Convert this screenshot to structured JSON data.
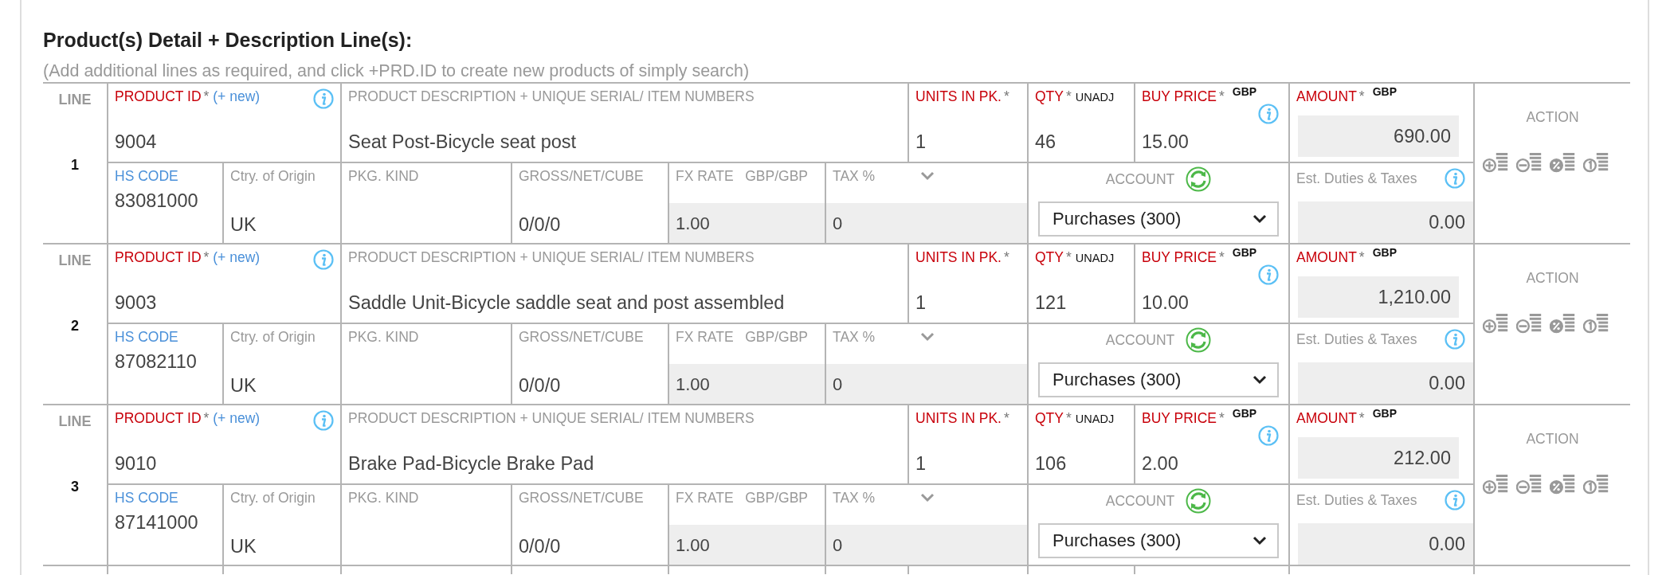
{
  "section": {
    "title": "Product(s) Detail + Description Line(s):",
    "hint": "(Add additional lines as required, and click +PRD.ID to create new products of simply search)"
  },
  "lines": [
    {
      "line_label": "LINE",
      "number": "1",
      "product_id": {
        "label": "PRODUCT ID",
        "mark": "*",
        "link": "(+ new)",
        "value": "9004"
      },
      "description": {
        "label": "PRODUCT DESCRIPTION + UNIQUE SERIAL/ ITEM NUMBERS",
        "value": "Seat Post-Bicycle seat post"
      },
      "units": {
        "label": "UNITS IN PK.",
        "mark": "*",
        "value": "1"
      },
      "qty": {
        "label": "QTY",
        "mark": "*",
        "unit": "UNADJ",
        "value": "46"
      },
      "buy_price": {
        "label": "BUY PRICE",
        "mark": "*",
        "currency": "GBP",
        "value": "15.00"
      },
      "amount": {
        "label": "AMOUNT",
        "mark": "*",
        "currency": "GBP",
        "value": "690.00"
      },
      "action": {
        "label": "ACTION"
      },
      "hs_code": {
        "label": "HS CODE",
        "value": "83081000"
      },
      "origin": {
        "label": "Ctry. of Origin",
        "value": "UK"
      },
      "pkg": {
        "label": "PKG. KIND"
      },
      "gross": {
        "label": "GROSS/NET/CUBE",
        "value": "0/0/0"
      },
      "fx": {
        "label": "FX RATE",
        "pair": "GBP/GBP",
        "value": "1.00"
      },
      "tax": {
        "label": "TAX %",
        "value": "0"
      },
      "account": {
        "label": "ACCOUNT",
        "value": "Purchases (300)"
      },
      "duties": {
        "label": "Est. Duties & Taxes",
        "value": "0.00"
      }
    },
    {
      "line_label": "LINE",
      "number": "2",
      "product_id": {
        "label": "PRODUCT ID",
        "mark": "*",
        "link": "(+ new)",
        "value": "9003"
      },
      "description": {
        "label": "PRODUCT DESCRIPTION + UNIQUE SERIAL/ ITEM NUMBERS",
        "value": "Saddle Unit-Bicycle saddle seat and post assembled"
      },
      "units": {
        "label": "UNITS IN PK.",
        "mark": "*",
        "value": "1"
      },
      "qty": {
        "label": "QTY",
        "mark": "*",
        "unit": "UNADJ",
        "value": "121"
      },
      "buy_price": {
        "label": "BUY PRICE",
        "mark": "*",
        "currency": "GBP",
        "value": "10.00"
      },
      "amount": {
        "label": "AMOUNT",
        "mark": "*",
        "currency": "GBP",
        "value": "1,210.00"
      },
      "action": {
        "label": "ACTION"
      },
      "hs_code": {
        "label": "HS CODE",
        "value": "87082110"
      },
      "origin": {
        "label": "Ctry. of Origin",
        "value": "UK"
      },
      "pkg": {
        "label": "PKG. KIND"
      },
      "gross": {
        "label": "GROSS/NET/CUBE",
        "value": "0/0/0"
      },
      "fx": {
        "label": "FX RATE",
        "pair": "GBP/GBP",
        "value": "1.00"
      },
      "tax": {
        "label": "TAX %",
        "value": "0"
      },
      "account": {
        "label": "ACCOUNT",
        "value": "Purchases (300)"
      },
      "duties": {
        "label": "Est. Duties & Taxes",
        "value": "0.00"
      }
    },
    {
      "line_label": "LINE",
      "number": "3",
      "product_id": {
        "label": "PRODUCT ID",
        "mark": "*",
        "link": "(+ new)",
        "value": "9010"
      },
      "description": {
        "label": "PRODUCT DESCRIPTION + UNIQUE SERIAL/ ITEM NUMBERS",
        "value": "Brake Pad-Bicycle Brake Pad"
      },
      "units": {
        "label": "UNITS IN PK.",
        "mark": "*",
        "value": "1"
      },
      "qty": {
        "label": "QTY",
        "mark": "*",
        "unit": "UNADJ",
        "value": "106"
      },
      "buy_price": {
        "label": "BUY PRICE",
        "mark": "*",
        "currency": "GBP",
        "value": "2.00"
      },
      "amount": {
        "label": "AMOUNT",
        "mark": "*",
        "currency": "GBP",
        "value": "212.00"
      },
      "action": {
        "label": "ACTION"
      },
      "hs_code": {
        "label": "HS CODE",
        "value": "87141000"
      },
      "origin": {
        "label": "Ctry. of Origin",
        "value": "UK"
      },
      "pkg": {
        "label": "PKG. KIND"
      },
      "gross": {
        "label": "GROSS/NET/CUBE",
        "value": "0/0/0"
      },
      "fx": {
        "label": "FX RATE",
        "pair": "GBP/GBP",
        "value": "1.00"
      },
      "tax": {
        "label": "TAX %",
        "value": "0"
      },
      "account": {
        "label": "ACCOUNT",
        "value": "Purchases (300)"
      },
      "duties": {
        "label": "Est. Duties & Taxes",
        "value": "0.00"
      }
    }
  ]
}
